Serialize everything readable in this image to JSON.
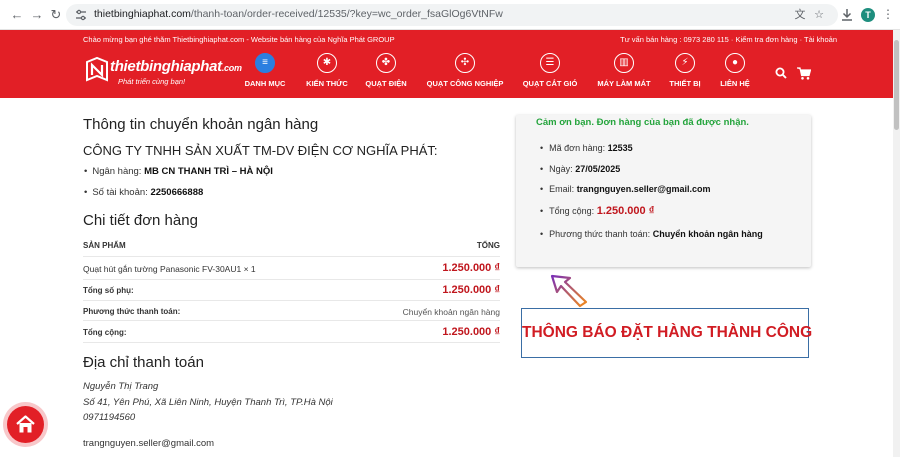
{
  "browser": {
    "url_host": "thietbinghiaphat.com",
    "url_path": "/thanh-toan/order-received/12535/?key=wc_order_fsaGlOg6VtNFw",
    "profile_initial": "T"
  },
  "header": {
    "welcome": "Chào mừng bạn ghé thăm Thietbinghiaphat.com - Website bán hàng của Nghĩa Phát GROUP",
    "hotline_text": "Tư vấn bán hàng : 0973 280 115 · Kiểm tra đơn hàng · Tài khoản",
    "logo_name": "thietbinghiaphat",
    "logo_domain": ".com",
    "logo_tagline": "Phát triển cùng bạn!",
    "menu": [
      {
        "label": "DANH MỤC",
        "icon": "menu-icon"
      },
      {
        "label": "KIẾN THỨC",
        "icon": "bulb-icon"
      },
      {
        "label": "QUẠT ĐIỆN",
        "icon": "fan-icon"
      },
      {
        "label": "QUẠT CÔNG NGHIỆP",
        "icon": "industrial-fan-icon"
      },
      {
        "label": "QUẠT CẮT GIÓ",
        "icon": "air-curtain-icon"
      },
      {
        "label": "MÁY LÀM MÁT",
        "icon": "cooler-icon"
      },
      {
        "label": "THIẾT BỊ",
        "icon": "device-icon"
      },
      {
        "label": "LIÊN HỆ",
        "icon": "location-icon"
      }
    ]
  },
  "bank": {
    "title": "Thông tin chuyển khoản ngân hàng",
    "company": "CÔNG TY TNHH SẢN XUẤT TM-DV ĐIỆN CƠ NGHĨA PHÁT:",
    "bank_label": "Ngân hàng:",
    "bank_value": "MB CN THANH TRÌ – HÀ NỘI",
    "account_label": "Số tài khoản:",
    "account_value": "2250666888"
  },
  "order_details": {
    "title": "Chi tiết đơn hàng",
    "col_product": "SẢN PHẨM",
    "col_total": "TỔNG",
    "item_name": "Quạt hút gắn tường Panasonic FV-30AU1 × 1",
    "item_price": "1.250.000 ₫",
    "subtotal_label": "Tổng số phụ:",
    "subtotal_value": "1.250.000 ₫",
    "payment_label": "Phương thức thanh toán:",
    "payment_value": "Chuyển khoản ngân hàng",
    "total_label": "Tổng cộng:",
    "total_value": "1.250.000 ₫"
  },
  "billing": {
    "title": "Địa chỉ thanh toán",
    "name": "Nguyễn Thị Trang",
    "address": "Số 41, Yên Phú, Xã Liên Ninh, Huyện Thanh Trì, TP.Hà Nội",
    "phone": "0971194560",
    "email": "trangnguyen.seller@gmail.com"
  },
  "summary": {
    "thanks": "Cảm ơn bạn. Đơn hàng của bạn đã được nhận.",
    "order_no_label": "Mã đơn hàng:",
    "order_no": "12535",
    "date_label": "Ngày:",
    "date": "27/05/2025",
    "email_label": "Email:",
    "email": "trangnguyen.seller@gmail.com",
    "total_label": "Tổng cộng:",
    "total": "1.250.000 ₫",
    "payment_label": "Phương thức thanh toán:",
    "payment": "Chuyển khoản ngân hàng"
  },
  "notice": "THÔNG BÁO ĐẶT HÀNG THÀNH CÔNG",
  "colors": {
    "brand_red": "#e21f26",
    "price_red": "#c0161d",
    "success_green": "#24a43c",
    "notice_border": "#3a6ea5"
  }
}
